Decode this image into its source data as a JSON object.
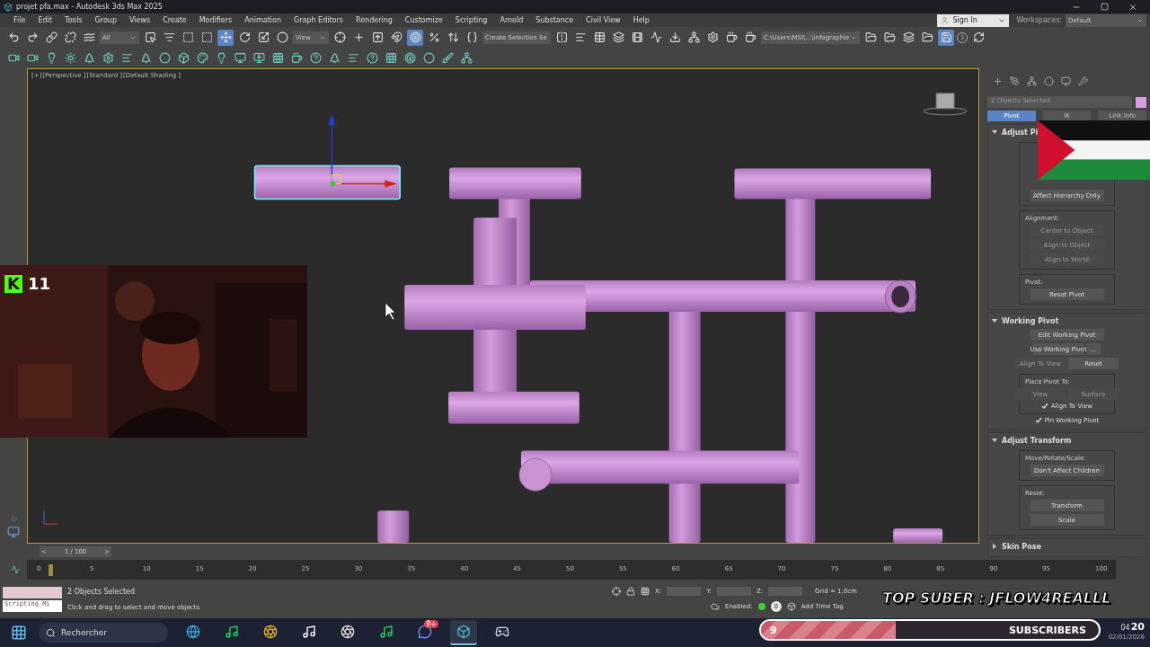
{
  "window": {
    "title": "projet pfa.max - Autodesk 3ds Max 2025"
  },
  "menu": [
    "File",
    "Edit",
    "Tools",
    "Group",
    "Views",
    "Create",
    "Modifiers",
    "Animation",
    "Graph Editors",
    "Rendering",
    "Customize",
    "Scripting",
    "Arnold",
    "Substance",
    "Civil View",
    "Help"
  ],
  "account": {
    "sign_in": "Sign In",
    "workspaces_label": "Workspaces:",
    "workspace": "Default"
  },
  "toolbar": {
    "selection_filter": "All",
    "reference_coord": "View",
    "named_selection": "Create Selection Se",
    "project_path": "C:\\Users\\MSI\\...\\infographie",
    "undo_levels": "3"
  },
  "viewport": {
    "labels": [
      "[+]",
      "[Perspective ]",
      "[Standard ]",
      "[Default Shading ]"
    ]
  },
  "command_panel": {
    "selection": "2 Objects Selected",
    "tabs": [
      {
        "label": "Pivot",
        "selected": true
      },
      {
        "label": "IK",
        "selected": false
      },
      {
        "label": "Link Info",
        "selected": false
      }
    ],
    "rollouts": [
      {
        "title": "Adjust Pi",
        "expanded": true,
        "items": [
          {
            "kind": "group",
            "items": [
              {
                "kind": "button",
                "label": "Affect Hierarchy Only",
                "disabled": false
              }
            ]
          },
          {
            "kind": "group",
            "label": "Alignment:",
            "items": [
              {
                "kind": "button",
                "label": "Center to Object",
                "disabled": true
              },
              {
                "kind": "button",
                "label": "Align to Object",
                "disabled": true
              },
              {
                "kind": "button",
                "label": "Align to World",
                "disabled": true
              }
            ]
          },
          {
            "kind": "group",
            "label": "Pivot:",
            "items": [
              {
                "kind": "button",
                "label": "Reset Pivot",
                "disabled": false
              }
            ]
          }
        ]
      },
      {
        "title": "Working Pivot",
        "expanded": true,
        "items": [
          {
            "kind": "button",
            "label": "Edit Working Pivot",
            "disabled": false
          },
          {
            "kind": "pair",
            "buttons": [
              {
                "label": "Use Working Pivot",
                "disabled": false
              },
              {
                "label": "...",
                "disabled": false
              }
            ]
          },
          {
            "kind": "pair",
            "buttons": [
              {
                "label": "Align To View",
                "disabled": true
              },
              {
                "label": "Reset",
                "disabled": false
              }
            ]
          },
          {
            "kind": "group",
            "label": "Place Pivot To:",
            "items": [
              {
                "kind": "pair",
                "buttons": [
                  {
                    "label": "View",
                    "disabled": true
                  },
                  {
                    "label": "Surface",
                    "disabled": true
                  }
                ]
              },
              {
                "kind": "checkbox",
                "label": "Align To View",
                "checked": true
              }
            ]
          },
          {
            "kind": "checkbox",
            "label": "Pin Working Pivot",
            "checked": true
          }
        ]
      },
      {
        "title": "Adjust Transform",
        "expanded": true,
        "items": [
          {
            "kind": "group",
            "label": "Move/Rotate/Scale:",
            "items": [
              {
                "kind": "button",
                "label": "Don't Affect Children",
                "disabled": false
              }
            ]
          },
          {
            "kind": "group",
            "label": "Reset:",
            "items": [
              {
                "kind": "button",
                "label": "Transform",
                "disabled": false
              },
              {
                "kind": "button",
                "label": "Scale",
                "disabled": false
              }
            ]
          }
        ]
      },
      {
        "title": "Skin Pose",
        "expanded": false
      }
    ]
  },
  "timeline": {
    "prev": "<",
    "range": "1 / 100",
    "next": ">",
    "level": 0,
    "ticks": [
      "0",
      "5",
      "10",
      "15",
      "20",
      "25",
      "30",
      "35",
      "40",
      "45",
      "50",
      "55",
      "60",
      "65",
      "70",
      "75",
      "80",
      "85",
      "90",
      "95",
      "100"
    ]
  },
  "status": {
    "script_listener": "Scripting Mi",
    "selected": "2 Objects Selected",
    "prompt": "Click and drag to select and move objects",
    "coords": [
      "X:",
      "Y:",
      "Z:"
    ],
    "grid": "Grid = 1,0cm",
    "time_tag": {
      "label": "Enabled:",
      "on": true,
      "count": "0"
    },
    "add_time_tag": "Add Time Tag"
  },
  "taskbar": {
    "search": "Rechercher",
    "apps": [
      {
        "kind": "edge",
        "selected": false
      },
      {
        "kind": "spotify",
        "selected": false
      },
      {
        "kind": "chrome",
        "selected": false
      },
      {
        "kind": "tiktok",
        "selected": false
      },
      {
        "kind": "obs",
        "selected": false
      },
      {
        "kind": "spotify",
        "selected": false
      },
      {
        "kind": "discord",
        "selected": false,
        "badge": "9+"
      },
      {
        "kind": "max",
        "selected": true
      },
      {
        "kind": "steam",
        "selected": false
      }
    ],
    "clock": {
      "hour": "04",
      "minute": "20",
      "date": "02/01/2026"
    }
  },
  "stream_overlay": {
    "follower_mark": "K",
    "follower_count": "11",
    "top_sub": "TOP SUBER : JFLOW4REALLL",
    "subscribers": {
      "count": "9",
      "label": "SUBSCRIBERS",
      "level": 0.4
    }
  }
}
